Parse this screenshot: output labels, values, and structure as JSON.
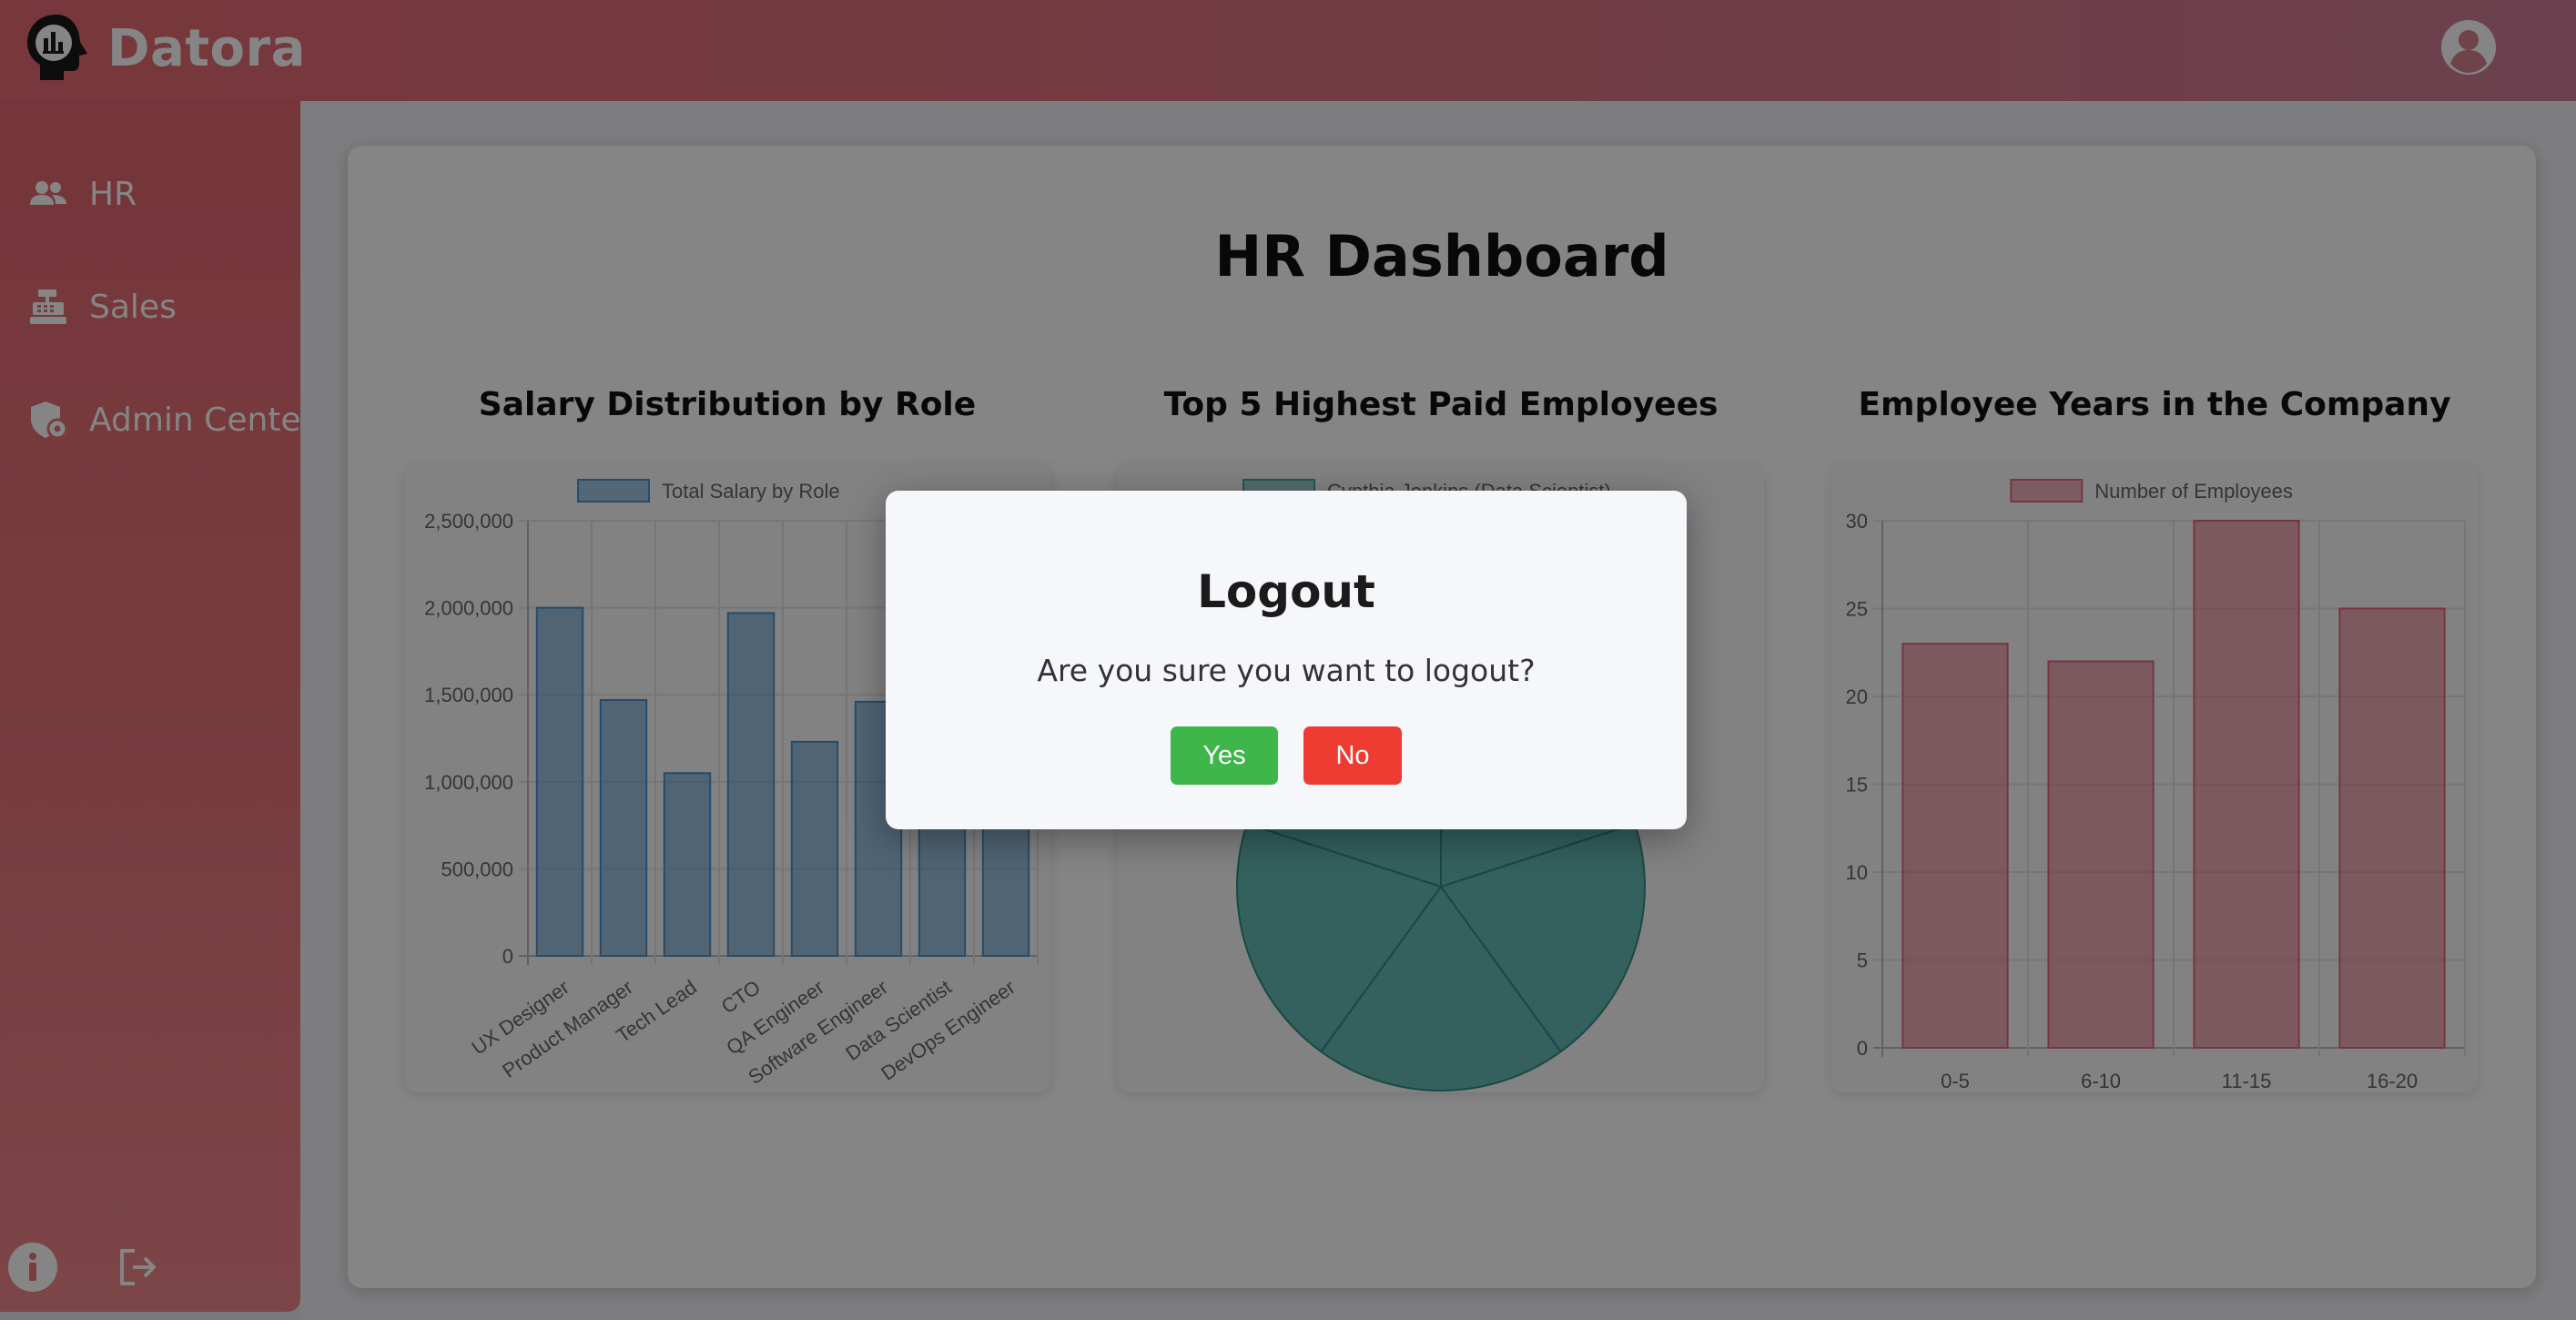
{
  "app": {
    "brand": "Datora"
  },
  "sidebar": {
    "items": [
      {
        "label": "HR",
        "icon": "people-icon"
      },
      {
        "label": "Sales",
        "icon": "cash-register-icon"
      },
      {
        "label": "Admin Center",
        "icon": "shield-gear-icon"
      }
    ],
    "bottom_icons": [
      "info-icon",
      "logout-icon"
    ]
  },
  "header": {
    "avatar_icon": "user-circle-icon"
  },
  "page": {
    "title": "HR Dashboard"
  },
  "charts": [
    {
      "title": "Salary Distribution by Role"
    },
    {
      "title": "Top 5 Highest Paid Employees"
    },
    {
      "title": "Employee Years in the Company"
    }
  ],
  "chart_data": [
    {
      "type": "bar",
      "title": "Salary Distribution by Role",
      "legend": "Total Salary by Role",
      "categories": [
        "UX Designer",
        "Product Manager",
        "Tech Lead",
        "CTO",
        "QA Engineer",
        "Software Engineer",
        "Data Scientist",
        "DevOps Engineer"
      ],
      "values": [
        2000000,
        1470000,
        1050000,
        1970000,
        1230000,
        1460000,
        1300000,
        1300000
      ],
      "yticks": [
        "0",
        "500,000",
        "1,000,000",
        "1,500,000",
        "2,000,000",
        "2,500,000"
      ],
      "ylim": [
        0,
        2500000
      ],
      "grid": true,
      "color": "#4a90c9"
    },
    {
      "type": "pie",
      "title": "Top 5 Highest Paid Employees",
      "legend_visible": "Cynthia Jenkins (Data Scientist)",
      "values": [
        1,
        1,
        1,
        1,
        1
      ],
      "color": "#3fa9a2"
    },
    {
      "type": "bar",
      "title": "Employee Years in the Company",
      "legend": "Number of Employees",
      "categories": [
        "0-5",
        "6-10",
        "11-15",
        "16-20"
      ],
      "values": [
        23,
        22,
        30,
        25
      ],
      "yticks": [
        "0",
        "5",
        "10",
        "15",
        "20",
        "25",
        "30"
      ],
      "ylim": [
        0,
        30
      ],
      "grid": true,
      "color": "#e2687d"
    }
  ],
  "modal": {
    "title": "Logout",
    "message": "Are you sure you want to logout?",
    "yes_label": "Yes",
    "no_label": "No"
  },
  "colors": {
    "header_start": "#e56a72",
    "header_end": "#cf7e98",
    "sidebar": "#e6757a",
    "yes": "#3eb64a",
    "no": "#ee3c33"
  }
}
